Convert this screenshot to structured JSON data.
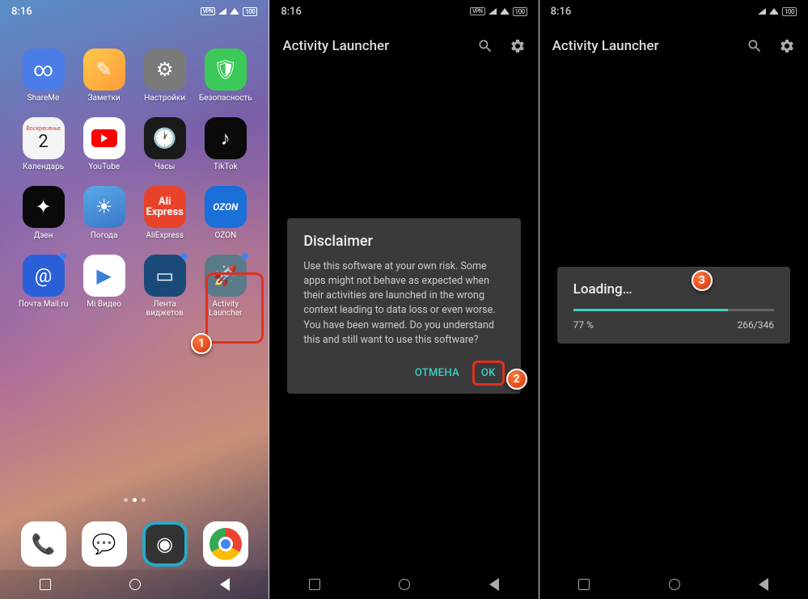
{
  "status": {
    "time": "8:16",
    "vpn": "VPN",
    "battery": "100"
  },
  "home": {
    "apps": [
      {
        "id": "shareme",
        "label": "ShareMe",
        "glyph": "∞"
      },
      {
        "id": "notes",
        "label": "Заметки",
        "glyph": "✎"
      },
      {
        "id": "settings",
        "label": "Настройки",
        "glyph": "⚙"
      },
      {
        "id": "security",
        "label": "Безопасность",
        "glyph": "🛡"
      },
      {
        "id": "calendar",
        "label": "Календарь",
        "weekday": "Воскресенье",
        "day": "2"
      },
      {
        "id": "youtube",
        "label": "YouTube"
      },
      {
        "id": "clock",
        "label": "Часы",
        "glyph": "🕐"
      },
      {
        "id": "tiktok",
        "label": "TikTok",
        "glyph": "♪"
      },
      {
        "id": "dzen",
        "label": "Дзен",
        "glyph": "✦"
      },
      {
        "id": "weather",
        "label": "Погода",
        "glyph": "☀"
      },
      {
        "id": "ali",
        "label": "AliExpress",
        "glyph": "Ali Express"
      },
      {
        "id": "ozon",
        "label": "OZON",
        "glyph": "OZON"
      },
      {
        "id": "mail",
        "label": "Почта Mail.ru",
        "glyph": "@",
        "dot": true
      },
      {
        "id": "mivideo",
        "label": "Mi Видео",
        "glyph": "▶"
      },
      {
        "id": "widgets",
        "label": "Лента виджетов",
        "glyph": "▭",
        "dot": true
      },
      {
        "id": "activity",
        "label": "Activity Launcher",
        "glyph": "🚀",
        "dot": true
      }
    ],
    "dock": [
      {
        "id": "phone",
        "glyph": "📞"
      },
      {
        "id": "messages",
        "glyph": "💬"
      },
      {
        "id": "camera",
        "glyph": "◉"
      },
      {
        "id": "chrome"
      }
    ]
  },
  "app": {
    "title": "Activity Launcher"
  },
  "dialog": {
    "title": "Disclaimer",
    "body": "Use this software at your own risk. Some apps might not behave as expected when their activities are launched in the wrong context leading to data loss or even worse. You have been warned. Do you understand this and still want to use this software?",
    "cancel": "ОТМЕНА",
    "ok": "OK"
  },
  "loading": {
    "title": "Loading…",
    "percent": "77 %",
    "count": "266/346",
    "progress": 77
  },
  "markers": {
    "m1": "1",
    "m2": "2",
    "m3": "3"
  }
}
